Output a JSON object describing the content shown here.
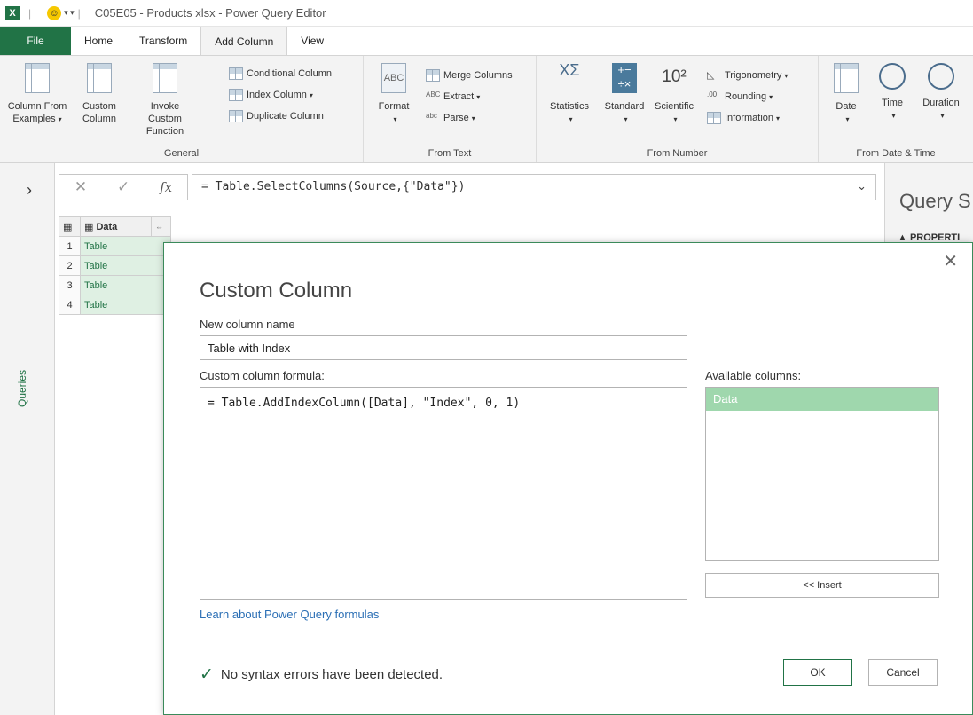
{
  "window": {
    "title": "C05E05 - Products xlsx - Power Query Editor",
    "excel_logo": "X"
  },
  "ribbon_tabs": [
    "File",
    "Home",
    "Transform",
    "Add Column",
    "View"
  ],
  "ribbon": {
    "general": {
      "label": "General",
      "column_from_examples": "Column From Examples",
      "custom_column": "Custom Column",
      "invoke_custom_function": "Invoke Custom Function",
      "conditional_column": "Conditional Column",
      "index_column": "Index Column",
      "duplicate_column": "Duplicate Column"
    },
    "from_text": {
      "label": "From Text",
      "format": "Format",
      "merge_columns": "Merge Columns",
      "extract": "Extract",
      "parse": "Parse"
    },
    "from_number": {
      "label": "From Number",
      "statistics": "Statistics",
      "standard": "Standard",
      "scientific": "Scientific",
      "trigonometry": "Trigonometry",
      "rounding": "Rounding",
      "information": "Information"
    },
    "from_date_time": {
      "label": "From Date & Time",
      "date": "Date",
      "time": "Time",
      "duration": "Duration"
    }
  },
  "sidebar": {
    "queries_label": "Queries"
  },
  "formula_bar": {
    "formula": "= Table.SelectColumns(Source,{\"Data\"})"
  },
  "query_settings": {
    "title": "Query S",
    "properties": "▲ PROPERTI"
  },
  "grid": {
    "column_header": "Data",
    "rows": [
      {
        "num": "1",
        "value": "Table"
      },
      {
        "num": "2",
        "value": "Table"
      },
      {
        "num": "3",
        "value": "Table"
      },
      {
        "num": "4",
        "value": "Table"
      }
    ]
  },
  "dialog": {
    "title": "Custom Column",
    "new_column_name_label": "New column name",
    "new_column_name_value": "Table with Index",
    "formula_label": "Custom column formula:",
    "formula_value": "= Table.AddIndexColumn([Data], \"Index\", 0, 1)",
    "available_columns_label": "Available columns:",
    "available_columns": [
      "Data"
    ],
    "insert_button": "<< Insert",
    "learn_link": "Learn about Power Query formulas",
    "status": "No syntax errors have been detected.",
    "ok_button": "OK",
    "cancel_button": "Cancel"
  },
  "colors": {
    "accent": "#217346",
    "selected_column": "#9fd7ad",
    "link": "#2b6fb5"
  }
}
